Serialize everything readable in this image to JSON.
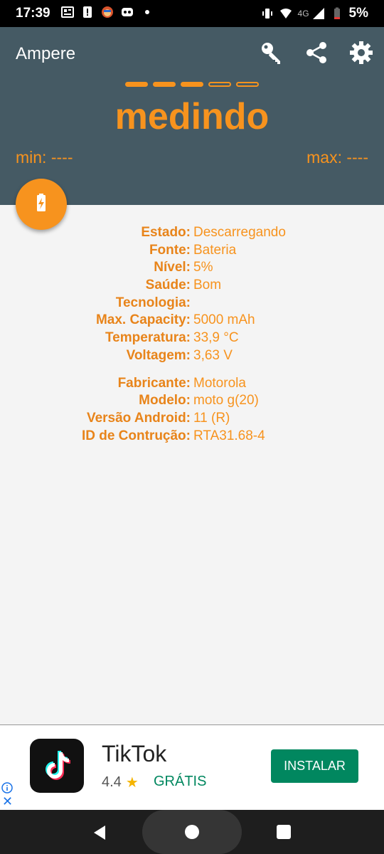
{
  "status_bar": {
    "time": "17:39",
    "battery_percent": "5%",
    "network_label": "4G",
    "icons_left": [
      "newspaper-icon",
      "alert-icon",
      "game-avatar-icon",
      "messenger-icon",
      "dot-icon"
    ],
    "icons_right": [
      "vibrate-icon",
      "wifi-icon",
      "signal-icon",
      "battery-icon"
    ]
  },
  "app_bar": {
    "title": "Ampere",
    "actions": [
      "key-icon",
      "share-icon",
      "settings-icon"
    ]
  },
  "measurement": {
    "progress_dashes_total": 5,
    "progress_dashes_filled": 3,
    "status_text": "medindo",
    "min_label": "min: ----",
    "max_label": "max: ----",
    "accent_color": "#f7931e",
    "header_color": "#455a64"
  },
  "battery_info": [
    {
      "label": "Estado:",
      "value": "Descarregando"
    },
    {
      "label": "Fonte:",
      "value": "Bateria"
    },
    {
      "label": "Nível:",
      "value": "5%"
    },
    {
      "label": "Saúde:",
      "value": "Bom"
    },
    {
      "label": "Tecnologia:",
      "value": ""
    },
    {
      "label": "Max. Capacity:",
      "value": "5000 mAh"
    },
    {
      "label": "Temperatura:",
      "value": "33,9 °C"
    },
    {
      "label": "Voltagem:",
      "value": "3,63 V"
    }
  ],
  "device_info": [
    {
      "label": "Fabricante:",
      "value": "Motorola"
    },
    {
      "label": "Modelo:",
      "value": "moto g(20)"
    },
    {
      "label": "Versão Android:",
      "value": "11 (R)"
    },
    {
      "label": "ID de Contrução:",
      "value": "RTA31.68-4"
    }
  ],
  "ad": {
    "app_name": "TikTok",
    "rating": "4.4",
    "price_label": "GRÁTIS",
    "install_label": "INSTALAR",
    "install_color": "#01875f"
  }
}
